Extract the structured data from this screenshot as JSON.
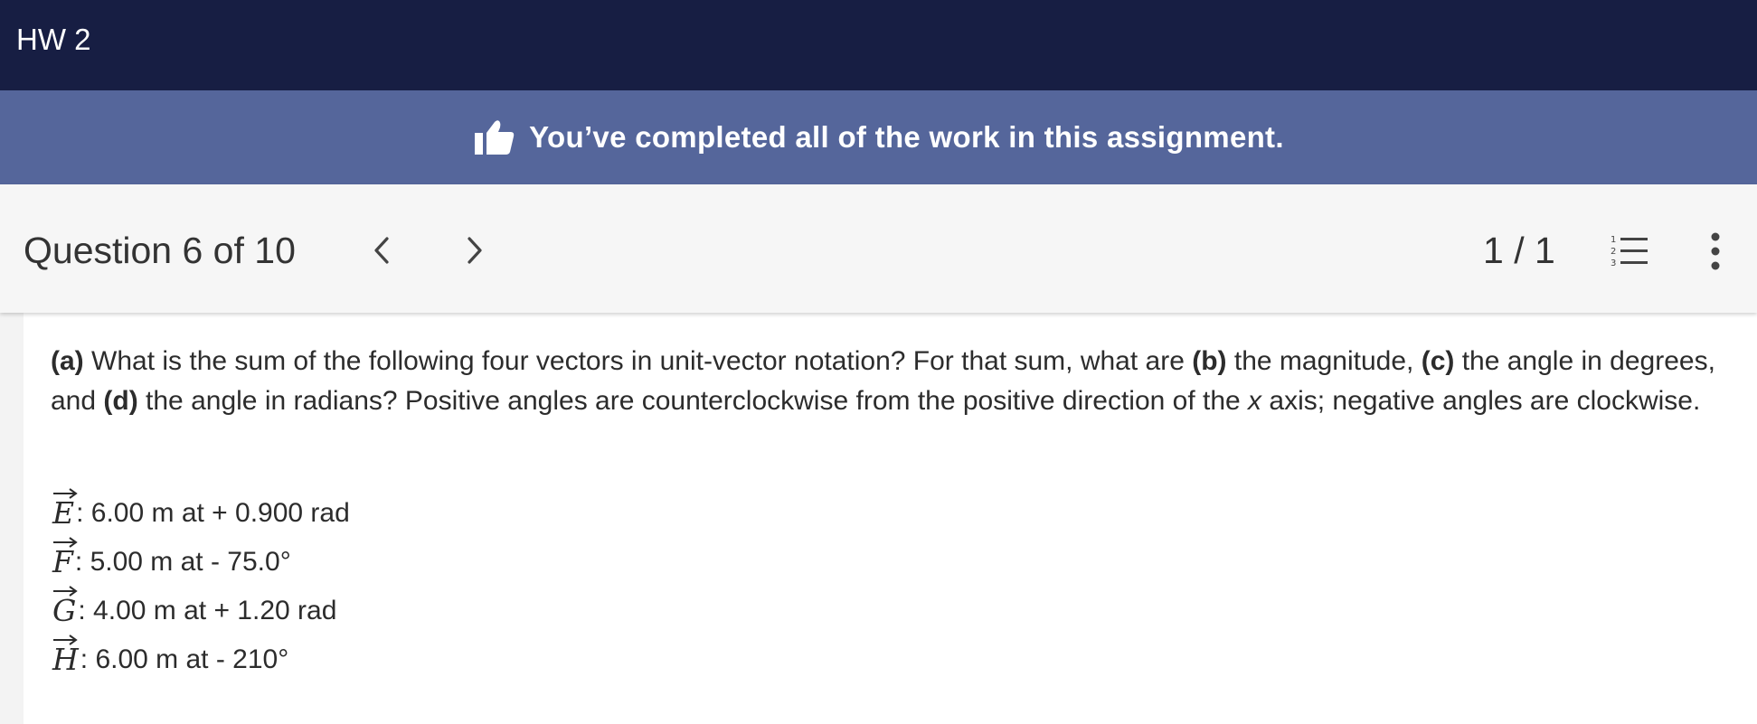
{
  "header": {
    "title": "HW 2"
  },
  "banner": {
    "message": "You’ve completed all of the work in this assignment.",
    "icon": "thumbs-up-icon"
  },
  "question_nav": {
    "title": "Question 6 of 10",
    "prev_icon": "chevron-left-icon",
    "next_icon": "chevron-right-icon",
    "pages": "1 / 1",
    "list_icon": "numbered-list-icon",
    "more_icon": "more-vertical-icon"
  },
  "question": {
    "part_a_label": "(a)",
    "text_1": " What is the sum of the following four vectors in unit-vector notation? For that sum, what are ",
    "part_b_label": "(b)",
    "text_2": " the magnitude, ",
    "part_c_label": "(c)",
    "text_3": " the angle in degrees, and ",
    "part_d_label": "(d)",
    "text_4": " the angle in radians? Positive angles are counterclockwise from the positive direction of the ",
    "axis_var": "x",
    "text_5": " axis; negative angles are clockwise."
  },
  "vectors": [
    {
      "symbol": "E",
      "desc": ": 6.00 m at + 0.900 rad"
    },
    {
      "symbol": "F",
      "desc": ": 5.00 m at - 75.0°"
    },
    {
      "symbol": "G",
      "desc": ": 4.00 m at + 1.20 rad"
    },
    {
      "symbol": "H",
      "desc": ": 6.00 m at - 210°"
    }
  ]
}
